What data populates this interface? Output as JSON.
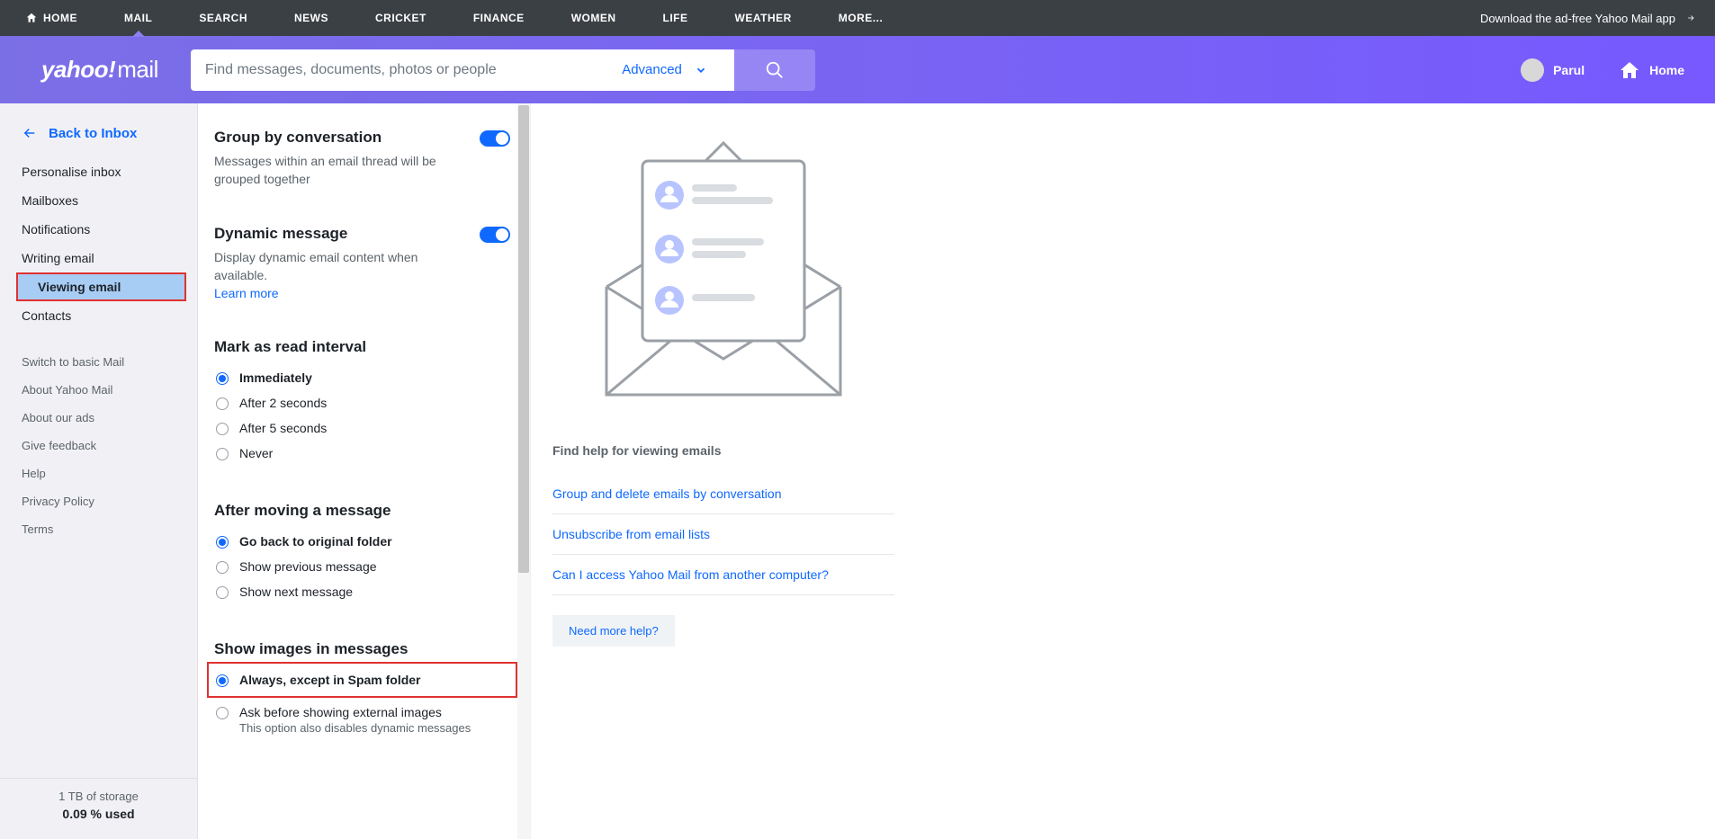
{
  "topnav": {
    "items": [
      {
        "label": "HOME",
        "icon": "home"
      },
      {
        "label": "MAIL",
        "active": true
      },
      {
        "label": "SEARCH"
      },
      {
        "label": "NEWS"
      },
      {
        "label": "CRICKET"
      },
      {
        "label": "FINANCE"
      },
      {
        "label": "WOMEN"
      },
      {
        "label": "LIFE"
      },
      {
        "label": "WEATHER"
      },
      {
        "label": "MORE..."
      }
    ],
    "download_label": "Download the ad-free Yahoo Mail app"
  },
  "header": {
    "logo_brand": "yahoo!",
    "logo_product": "mail",
    "search_placeholder": "Find messages, documents, photos or people",
    "advanced_label": "Advanced",
    "user_name": "Parul",
    "home_label": "Home"
  },
  "sidebar": {
    "back_label": "Back to Inbox",
    "primary": [
      "Personalise inbox",
      "Mailboxes",
      "Notifications",
      "Writing email",
      "Viewing email",
      "Contacts"
    ],
    "selected_index": 4,
    "secondary": [
      "Switch to basic Mail",
      "About Yahoo Mail",
      "About our ads",
      "Give feedback",
      "Help",
      "Privacy Policy",
      "Terms"
    ],
    "storage_line1": "1 TB of storage",
    "storage_line2": "0.09 % used"
  },
  "settings": {
    "group_conv": {
      "title": "Group by conversation",
      "desc": "Messages within an email thread will be grouped together",
      "on": true
    },
    "dynamic": {
      "title": "Dynamic message",
      "desc": "Display dynamic email content when available. ",
      "learn_more": "Learn more",
      "on": true
    },
    "mark_read": {
      "title": "Mark as read interval",
      "options": [
        "Immediately",
        "After 2 seconds",
        "After 5 seconds",
        "Never"
      ],
      "selected": 0
    },
    "after_move": {
      "title": "After moving a message",
      "options": [
        "Go back to original folder",
        "Show previous message",
        "Show next message"
      ],
      "selected": 0
    },
    "show_images": {
      "title": "Show images in messages",
      "option0": {
        "label": "Always, except in Spam folder"
      },
      "option1": {
        "label": "Ask before showing external images",
        "sub": "This option also disables dynamic messages"
      },
      "selected": 0
    }
  },
  "help": {
    "title": "Find help for viewing emails",
    "links": [
      "Group and delete emails by conversation",
      "Unsubscribe from email lists",
      "Can I access Yahoo Mail from another computer?"
    ],
    "more": "Need more help?"
  }
}
